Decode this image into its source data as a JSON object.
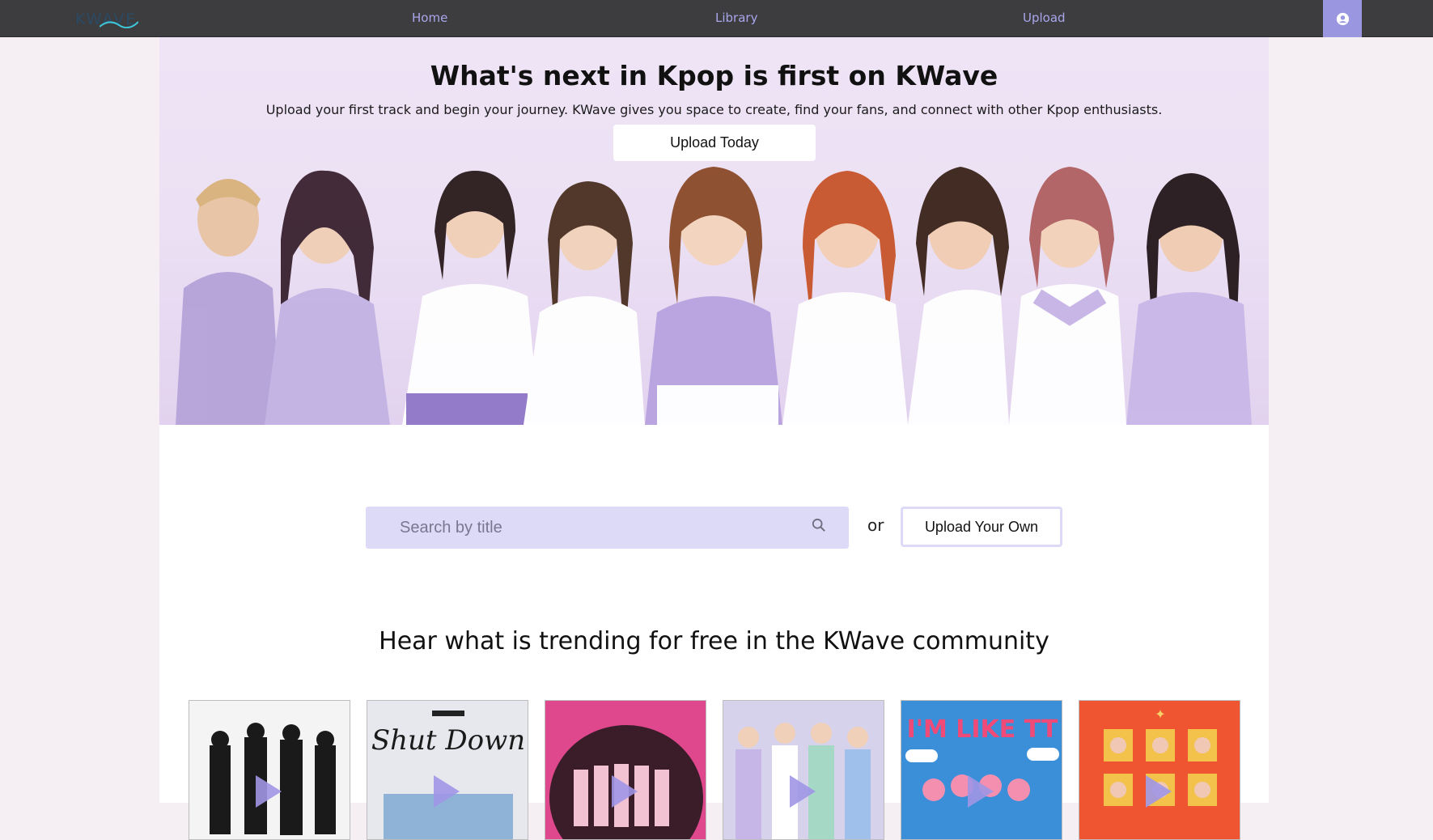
{
  "nav": {
    "logo": "KWAVE",
    "links": [
      "Home",
      "Library",
      "Upload"
    ],
    "profile_icon": "user-circle-icon"
  },
  "hero": {
    "title": "What's next in Kpop is first on KWave",
    "subtitle": "Upload your first track and begin your journey. KWave gives you space to create, find your fans, and connect with other Kpop enthusiasts.",
    "button": "Upload Today"
  },
  "search": {
    "placeholder": "Search by title",
    "icon": "search-icon",
    "or_text": "or",
    "upload_button": "Upload Your Own"
  },
  "trending": {
    "heading": "Hear what is trending for free in the KWave community",
    "cards": [
      {
        "art_text": "",
        "icon": "play-icon"
      },
      {
        "art_text": "Shut Down",
        "icon": "play-icon"
      },
      {
        "art_text": "",
        "icon": "play-icon"
      },
      {
        "art_text": "",
        "icon": "play-icon"
      },
      {
        "art_text": "I'M LIKE TT",
        "icon": "play-icon"
      },
      {
        "art_text": "",
        "icon": "play-icon"
      }
    ]
  },
  "colors": {
    "nav_bg": "#3d3d3f",
    "accent": "#9a96e0",
    "nav_link": "#a9a6ec",
    "search_bg": "#dcdaf7"
  }
}
